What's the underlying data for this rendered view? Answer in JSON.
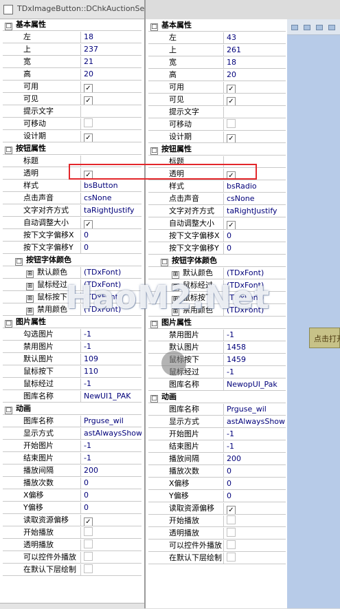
{
  "window": {
    "title": "TDxImageButton::DChkAuctionSell"
  },
  "left_panel": [
    {
      "kind": "cat",
      "pm": "□",
      "label": "基本属性"
    },
    {
      "kind": "prop",
      "label": "左",
      "value": "18"
    },
    {
      "kind": "prop",
      "label": "上",
      "value": "237"
    },
    {
      "kind": "prop",
      "label": "宽",
      "value": "21"
    },
    {
      "kind": "prop",
      "label": "高",
      "value": "20"
    },
    {
      "kind": "prop",
      "label": "可用",
      "check": true
    },
    {
      "kind": "prop",
      "label": "可见",
      "check": true
    },
    {
      "kind": "prop",
      "label": "提示文字",
      "value": ""
    },
    {
      "kind": "prop",
      "label": "可移动",
      "check": false
    },
    {
      "kind": "prop",
      "label": "设计期",
      "check": true
    },
    {
      "kind": "cat",
      "pm": "□",
      "label": "按钮属性"
    },
    {
      "kind": "prop",
      "label": "标题",
      "value": ""
    },
    {
      "kind": "prop",
      "label": "透明",
      "check": true
    },
    {
      "kind": "prop",
      "label": "样式",
      "value": "bsButton"
    },
    {
      "kind": "prop",
      "label": "点击声音",
      "value": "csNone"
    },
    {
      "kind": "prop",
      "label": "文字对齐方式",
      "value": "taRightJustify"
    },
    {
      "kind": "prop",
      "label": "自动调整大小",
      "check": true
    },
    {
      "kind": "prop",
      "label": "按下文字偏移X",
      "value": "0"
    },
    {
      "kind": "prop",
      "label": "按下文字偏移Y",
      "value": "0"
    },
    {
      "kind": "subcat",
      "pm": "□",
      "label": "按钮字体颜色"
    },
    {
      "kind": "sub",
      "pm": "⊞",
      "label": "默认颜色",
      "value": "(TDxFont)"
    },
    {
      "kind": "sub",
      "pm": "⊞",
      "label": "鼠标经过",
      "value": "(TDxFont)"
    },
    {
      "kind": "sub",
      "pm": "⊞",
      "label": "鼠标按下",
      "value": "(TDxFont)"
    },
    {
      "kind": "sub",
      "pm": "⊞",
      "label": "禁用颜色",
      "value": "(TDxFont)"
    },
    {
      "kind": "cat",
      "pm": "□",
      "label": "图片属性"
    },
    {
      "kind": "prop",
      "label": "勾选图片",
      "value": "-1"
    },
    {
      "kind": "prop",
      "label": "禁用图片",
      "value": "-1"
    },
    {
      "kind": "prop",
      "label": "默认图片",
      "value": "109"
    },
    {
      "kind": "prop",
      "label": "鼠标按下",
      "value": "110"
    },
    {
      "kind": "prop",
      "label": "鼠标经过",
      "value": "-1"
    },
    {
      "kind": "prop",
      "label": "图库名称",
      "value": "NewUI1_PAK"
    },
    {
      "kind": "cat",
      "pm": "□",
      "label": "动画"
    },
    {
      "kind": "prop",
      "label": "图库名称",
      "value": "Prguse_wil"
    },
    {
      "kind": "prop",
      "label": "显示方式",
      "value": "astAlwaysShow"
    },
    {
      "kind": "prop",
      "label": "开始图片",
      "value": "-1"
    },
    {
      "kind": "prop",
      "label": "结束图片",
      "value": "-1"
    },
    {
      "kind": "prop",
      "label": "播放间隔",
      "value": "200"
    },
    {
      "kind": "prop",
      "label": "播放次数",
      "value": "0"
    },
    {
      "kind": "prop",
      "label": "X偏移",
      "value": "0"
    },
    {
      "kind": "prop",
      "label": "Y偏移",
      "value": "0"
    },
    {
      "kind": "prop",
      "label": "读取资源偏移",
      "check": true
    },
    {
      "kind": "prop",
      "label": "开始播放",
      "check": false
    },
    {
      "kind": "prop",
      "label": "透明播放",
      "check": false
    },
    {
      "kind": "prop",
      "label": "可以控件外播放",
      "check": false
    },
    {
      "kind": "prop",
      "label": "在默认下层绘制",
      "check": false
    }
  ],
  "right_panel": [
    {
      "kind": "cat",
      "pm": "□",
      "label": "基本属性"
    },
    {
      "kind": "prop",
      "label": "左",
      "value": "43"
    },
    {
      "kind": "prop",
      "label": "上",
      "value": "261"
    },
    {
      "kind": "prop",
      "label": "宽",
      "value": "18"
    },
    {
      "kind": "prop",
      "label": "高",
      "value": "20"
    },
    {
      "kind": "prop",
      "label": "可用",
      "check": true
    },
    {
      "kind": "prop",
      "label": "可见",
      "check": true
    },
    {
      "kind": "prop",
      "label": "提示文字",
      "value": ""
    },
    {
      "kind": "prop",
      "label": "可移动",
      "check": false
    },
    {
      "kind": "prop",
      "label": "设计期",
      "check": true
    },
    {
      "kind": "cat",
      "pm": "□",
      "label": "按钮属性"
    },
    {
      "kind": "prop",
      "label": "标题",
      "value": ""
    },
    {
      "kind": "prop",
      "label": "透明",
      "check": true
    },
    {
      "kind": "prop",
      "label": "样式",
      "value": "bsRadio"
    },
    {
      "kind": "prop",
      "label": "点击声音",
      "value": "csNone"
    },
    {
      "kind": "prop",
      "label": "文字对齐方式",
      "value": "taRightJustify"
    },
    {
      "kind": "prop",
      "label": "自动调整大小",
      "check": true
    },
    {
      "kind": "prop",
      "label": "按下文字偏移X",
      "value": "0"
    },
    {
      "kind": "prop",
      "label": "按下文字偏移Y",
      "value": "0"
    },
    {
      "kind": "subcat",
      "pm": "□",
      "label": "按钮字体颜色"
    },
    {
      "kind": "sub",
      "pm": "⊞",
      "label": "默认颜色",
      "value": "(TDxFont)"
    },
    {
      "kind": "sub",
      "pm": "⊞",
      "label": "鼠标经过",
      "value": "(TDxFont)"
    },
    {
      "kind": "sub",
      "pm": "⊞",
      "label": "鼠标按下",
      "value": "(TDxFont)"
    },
    {
      "kind": "sub",
      "pm": "⊞",
      "label": "禁用颜色",
      "value": "(TDxFont)"
    },
    {
      "kind": "cat",
      "pm": "□",
      "label": "图片属性"
    },
    {
      "kind": "prop",
      "label": "禁用图片",
      "value": "-1"
    },
    {
      "kind": "prop",
      "label": "默认图片",
      "value": "1458"
    },
    {
      "kind": "prop",
      "label": "鼠标按下",
      "value": "1459"
    },
    {
      "kind": "prop",
      "label": "鼠标经过",
      "value": "-1"
    },
    {
      "kind": "prop",
      "label": "图库名称",
      "value": "NewopUI_Pak"
    },
    {
      "kind": "cat",
      "pm": "□",
      "label": "动画"
    },
    {
      "kind": "prop",
      "label": "图库名称",
      "value": "Prguse_wil"
    },
    {
      "kind": "prop",
      "label": "显示方式",
      "value": "astAlwaysShow"
    },
    {
      "kind": "prop",
      "label": "开始图片",
      "value": "-1"
    },
    {
      "kind": "prop",
      "label": "结束图片",
      "value": "-1"
    },
    {
      "kind": "prop",
      "label": "播放间隔",
      "value": "200"
    },
    {
      "kind": "prop",
      "label": "播放次数",
      "value": "0"
    },
    {
      "kind": "prop",
      "label": "X偏移",
      "value": "0"
    },
    {
      "kind": "prop",
      "label": "Y偏移",
      "value": "0"
    },
    {
      "kind": "prop",
      "label": "读取资源偏移",
      "check": true
    },
    {
      "kind": "prop",
      "label": "开始播放",
      "check": false
    },
    {
      "kind": "prop",
      "label": "透明播放",
      "check": false
    },
    {
      "kind": "prop",
      "label": "可以控件外播放",
      "check": false
    },
    {
      "kind": "prop",
      "label": "在默认下层绘制",
      "check": false
    }
  ],
  "canvas": {
    "gold_label": "点击打开"
  },
  "watermark": "HaoM2.Net",
  "colors": {
    "highlight": "#e3262a",
    "value_text": "#00007a",
    "canvas_bg": "#b7cbe8"
  }
}
